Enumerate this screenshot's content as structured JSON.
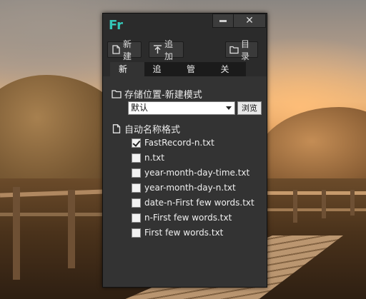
{
  "app": {
    "logo": "Fr",
    "close_glyph": "✕"
  },
  "toolbar": {
    "new_label": "新建",
    "add_label": "追加",
    "dir_label": "目录"
  },
  "tabs": [
    {
      "label": "新建",
      "active": true
    },
    {
      "label": "追加",
      "active": false
    },
    {
      "label": "管理",
      "active": false
    },
    {
      "label": "关于",
      "active": false
    }
  ],
  "storage": {
    "title": "存储位置-新建模式",
    "selected": "默认",
    "browse_label": "浏览"
  },
  "naming": {
    "title": "自动名称格式",
    "options": [
      {
        "label": "FastRecord-n.txt",
        "checked": true
      },
      {
        "label": "n.txt",
        "checked": false
      },
      {
        "label": "year-month-day-time.txt",
        "checked": false
      },
      {
        "label": "year-month-day-n.txt",
        "checked": false
      },
      {
        "label": "date-n-First few words.txt",
        "checked": false
      },
      {
        "label": "n-First few words.txt",
        "checked": false
      },
      {
        "label": "First few words.txt",
        "checked": false
      }
    ]
  },
  "icons": {
    "new": "document-icon",
    "add": "upload-icon",
    "dir": "folder-icon",
    "storage": "folder-icon",
    "naming": "document-icon"
  },
  "colors": {
    "logo": "#35c6b8",
    "window_bg": "#2b2b2b",
    "content_bg": "#333333"
  }
}
